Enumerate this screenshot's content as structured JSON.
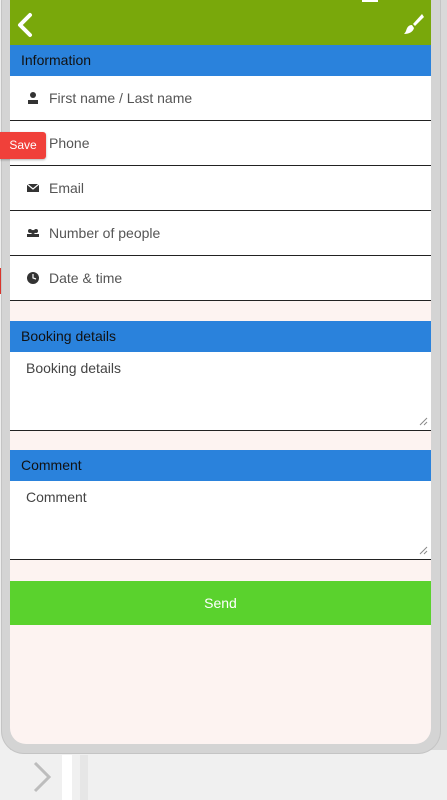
{
  "header": {
    "back_icon": "chevron-left-icon",
    "brush_icon": "paint-brush-icon",
    "color": "#79a80b"
  },
  "sections": {
    "information": "Information",
    "booking_details": "Booking details",
    "comment": "Comment"
  },
  "fields": {
    "name": {
      "icon": "person-icon",
      "placeholder": "First name / Last name"
    },
    "phone": {
      "icon": "phone-icon",
      "placeholder": "Phone"
    },
    "email": {
      "icon": "envelope-icon",
      "placeholder": "Email"
    },
    "people": {
      "icon": "group-icon",
      "placeholder": "Number of people"
    },
    "datetime": {
      "icon": "clock-icon",
      "placeholder": "Date & time"
    }
  },
  "textareas": {
    "booking_details": {
      "placeholder": "Booking details"
    },
    "comment": {
      "placeholder": "Comment"
    }
  },
  "send_button": {
    "label": "Send",
    "color": "#5ad22d"
  },
  "save_button": {
    "label": "Save",
    "color": "#f0403a"
  },
  "section_color": "#2a82dc",
  "screen_background": "#fdf3f1"
}
